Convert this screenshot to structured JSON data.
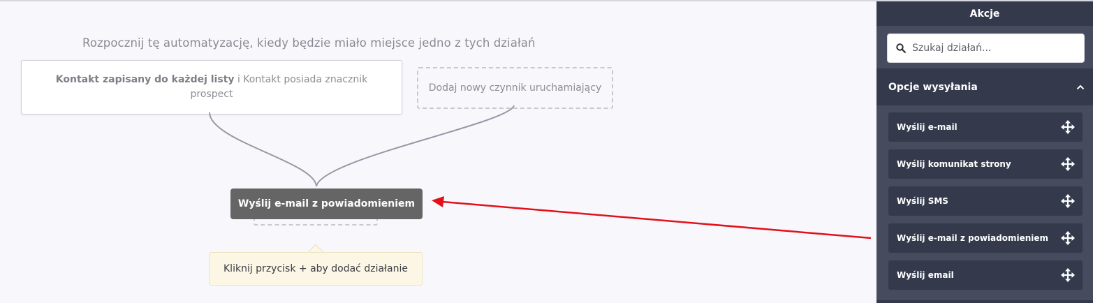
{
  "canvas": {
    "headline": "Rozpocznij tę automatyzację, kiedy będzie miało miejsce jedno z tych działań",
    "trigger": {
      "bold_part": "Kontakt zapisany do każdej listy",
      "regular_part": " i Kontakt posiada znacznik prospect"
    },
    "add_trigger_label": "Dodaj nowy czynnik uruchamiający",
    "action_node_label": "Wyślij e-mail z powiadomieniem",
    "tooltip_text": "Kliknij przycisk + aby dodać działanie",
    "annotation_arrow_color": "#e3101a"
  },
  "sidebar": {
    "title": "Akcje",
    "search": {
      "placeholder": "Szukaj działań..."
    },
    "section": {
      "label": "Opcje wysyłania",
      "icon": "chevron-up-icon"
    },
    "items": [
      {
        "label": "Wyślij e-mail",
        "icon": "move-icon"
      },
      {
        "label": "Wyślij komunikat strony",
        "icon": "move-icon"
      },
      {
        "label": "Wyślij SMS",
        "icon": "move-icon"
      },
      {
        "label": "Wyślij e-mail z powiadomieniem",
        "icon": "move-icon"
      },
      {
        "label": "Wyślij email",
        "icon": "move-icon"
      }
    ]
  },
  "colors": {
    "sidebar_bg": "#464c5e",
    "sidebar_dark": "#343a4c",
    "action_node_bg": "#656565",
    "tooltip_bg": "#fcf7e4"
  }
}
